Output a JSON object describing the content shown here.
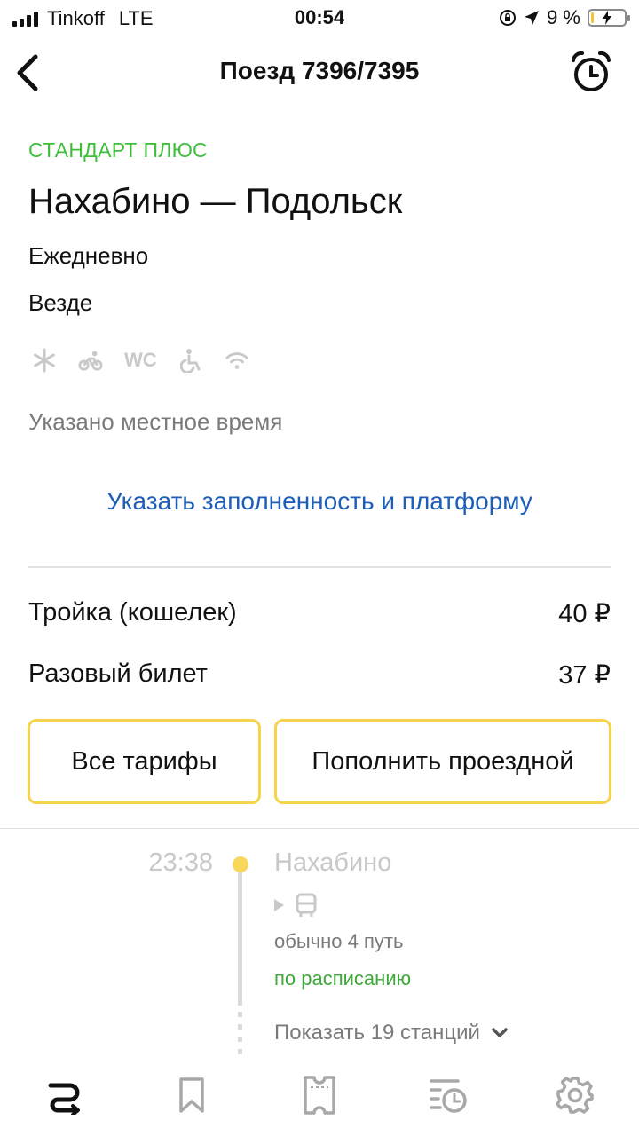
{
  "status_bar": {
    "carrier": "Tinkoff",
    "network": "LTE",
    "time": "00:54",
    "battery_text": "9 %",
    "battery_level": 0.09,
    "battery_color": "#f5c33b"
  },
  "nav": {
    "title": "Поезд 7396/7395",
    "back_icon": "chevron-left-icon",
    "alarm_icon": "alarm-clock-icon"
  },
  "train": {
    "class_label": "СТАНДАРТ ПЛЮС",
    "class_color": "#3fbe3b",
    "route": "Нахабино — Подольск",
    "days": "Ежедневно",
    "stops": "Везде",
    "amenities": [
      "snowflake-icon",
      "bicycle-icon",
      "WC",
      "wheelchair-icon",
      "wifi-icon"
    ],
    "amenity_wc_label": "WC",
    "local_time_note": "Указано местное время"
  },
  "actions": {
    "report_link": "Указать заполненность и платформу",
    "link_color": "#1d5fb8"
  },
  "fares": [
    {
      "name": "Тройка (кошелек)",
      "price": "40 ₽"
    },
    {
      "name": "Разовый билет",
      "price": "37 ₽"
    }
  ],
  "buttons": {
    "all_tariffs": "Все тарифы",
    "top_up": "Пополнить проездной",
    "border_color": "#f5d34c"
  },
  "stop": {
    "time": "23:38",
    "name": "Нахабино",
    "track": "обычно 4 путь",
    "status": "по расписанию",
    "status_color": "#3fa83a",
    "show_stations": "Показать 19 станций"
  },
  "tabbar": {
    "items": [
      "routes-icon",
      "bookmark-icon",
      "ticket-icon",
      "history-icon",
      "gear-icon"
    ]
  }
}
